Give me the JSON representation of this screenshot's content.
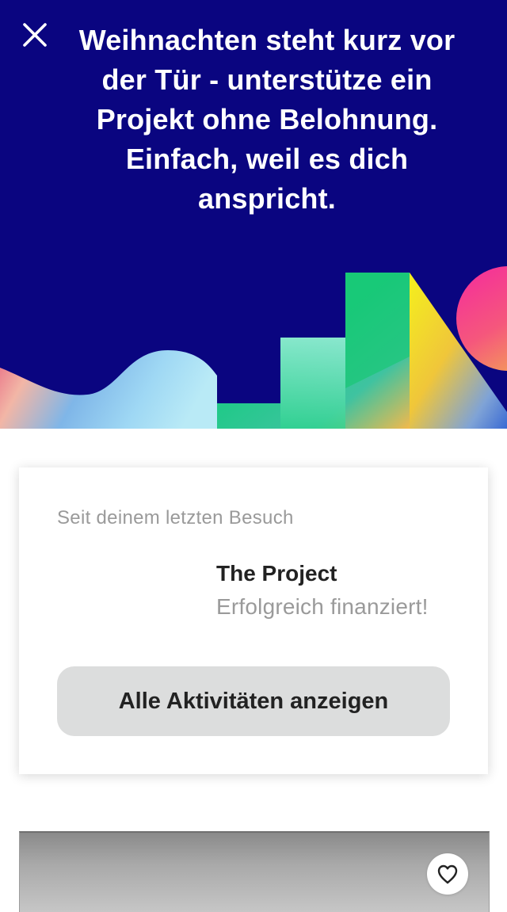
{
  "banner": {
    "close_icon": "close-icon",
    "text": "Weihnachten steht kurz vor der Tür - unterstütze ein Projekt ohne Belohnung. Einfach, weil es dich anspricht.",
    "colors": {
      "background": "#0a0580",
      "text": "#ffffff"
    }
  },
  "activity": {
    "header": "Seit deinem letzten Besuch",
    "project_title": "The Project",
    "project_status": "Erfolgreich finanziert!",
    "button_label": "Alle Aktivitäten anzeigen"
  },
  "project_card": {
    "favorite_icon": "heart-icon"
  }
}
